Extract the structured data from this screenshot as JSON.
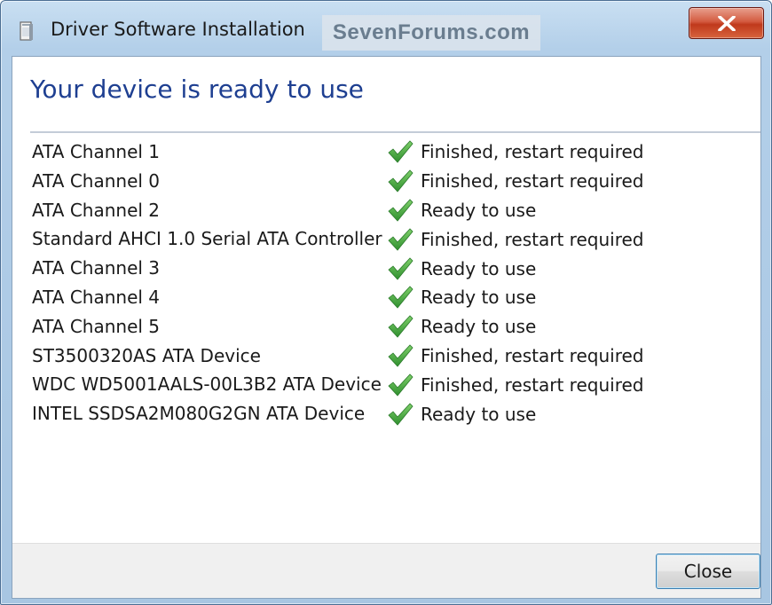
{
  "window": {
    "title": "Driver Software Installation",
    "watermark": "SevenForums.com"
  },
  "main": {
    "heading": "Your device is ready to use",
    "devices": [
      {
        "name": "ATA Channel 1",
        "status": "Finished, restart required"
      },
      {
        "name": "ATA Channel 0",
        "status": "Finished, restart required"
      },
      {
        "name": "ATA Channel 2",
        "status": "Ready to use"
      },
      {
        "name": "Standard AHCI 1.0 Serial ATA Controller",
        "status": "Finished, restart required"
      },
      {
        "name": "ATA Channel 3",
        "status": "Ready to use"
      },
      {
        "name": "ATA Channel 4",
        "status": "Ready to use"
      },
      {
        "name": "ATA Channel 5",
        "status": "Ready to use"
      },
      {
        "name": "ST3500320AS ATA Device",
        "status": "Finished, restart required"
      },
      {
        "name": "WDC WD5001AALS-00L3B2 ATA Device",
        "status": "Finished, restart required"
      },
      {
        "name": "INTEL SSDSA2M080G2GN ATA Device",
        "status": "Ready to use"
      }
    ]
  },
  "footer": {
    "close_label": "Close"
  },
  "icons": {
    "status": "green-checkmark-icon",
    "app": "driver-package-icon",
    "title_close": "close-x-icon"
  },
  "colors": {
    "heading": "#1e3f91",
    "check": "#3aa13a",
    "close_title_button": "#c0391c"
  }
}
